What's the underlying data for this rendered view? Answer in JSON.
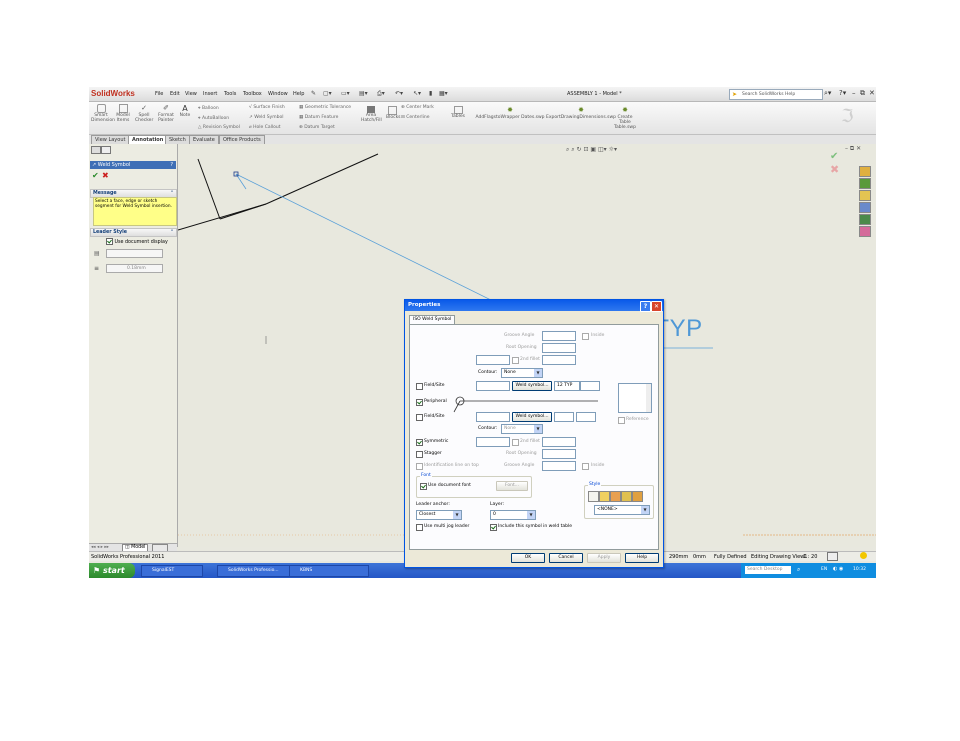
{
  "app": {
    "logo": "SolidWorks",
    "menus": [
      "File",
      "Edit",
      "View",
      "Insert",
      "Tools",
      "Toolbox",
      "Window",
      "Help"
    ],
    "title": "ASSEMBLY 1 - Model *",
    "search_placeholder": "Search SolidWorks Help"
  },
  "commands": {
    "smart_dimension": "Smart Dimension",
    "model_items": "Model Items",
    "spell_checker": "Spell Checker",
    "format_painter": "Format Painter",
    "note": "Note",
    "small": [
      "Balloon",
      "AutoBalloon",
      "Revision Symbol",
      "Surface Finish",
      "Weld Symbol",
      "Hole Callout",
      "Geometric Tolerance",
      "Datum Feature",
      "Datum Target",
      "Area Hatch/Fill",
      "Blocks",
      "Center Mark",
      "Centerline",
      "Tables",
      "AddFlagstoWrapper Dates.swp",
      "ExportDrawingDimensions.swp",
      "Create Table",
      "Table.swp"
    ]
  },
  "tabs": [
    "View Layout",
    "Annotation",
    "Sketch",
    "Evaluate",
    "Office Products"
  ],
  "left_panel": {
    "title": "Weld Symbol",
    "help": "?",
    "message_header": "Message",
    "message": "Select a face, edge or sketch segment for Weld Symbol insertion.",
    "leader_header": "Leader Style",
    "use_doc_display": "Use document display",
    "line_width": "0.18mm"
  },
  "canvas": {
    "weld_text": "12 TYP"
  },
  "bottom_tabs": [
    "Model"
  ],
  "status": {
    "edition": "SolidWorks Professional 2011",
    "x": "290mm",
    "y": "0mm",
    "state": "Fully Defined",
    "editing": "Editing Drawing View1",
    "scale": "1 : 20"
  },
  "taskbar": {
    "start": "start",
    "items": [
      "SignalEST",
      "SolidWorks Professio...",
      "KBNS"
    ],
    "search": "Search Desktop",
    "lang": "EN",
    "clock": "10:32"
  },
  "dialog": {
    "title": "Properties",
    "tab": "ISO Weld Symbol",
    "groove_angle": "Groove Angle",
    "root_opening": "Root Opening",
    "second_fillet": "2nd fillet",
    "inside": "Inside",
    "contour": "Contour:",
    "contour_value": "None",
    "field_site": "Field/Site",
    "weld_symbol_btn": "Weld symbol...",
    "top_value": "12 TYP",
    "peripheral": "Peripheral",
    "reference": "Reference",
    "symmetric": "Symmetric",
    "stagger": "Stagger",
    "ident_line": "Identification line on top",
    "font_group": "Font",
    "use_doc_font": "Use document font",
    "font_btn": "Font...",
    "style_group": "Style",
    "style_value": "<NONE>",
    "leader_anchor": "Leader anchor:",
    "leader_anchor_value": "Closest",
    "layer": "Layer:",
    "layer_value": "0",
    "multi_jog": "Use multi jog leader",
    "include_symbol": "Include this symbol in weld table",
    "ok": "OK",
    "cancel": "Cancel",
    "apply": "Apply",
    "help": "Help"
  }
}
